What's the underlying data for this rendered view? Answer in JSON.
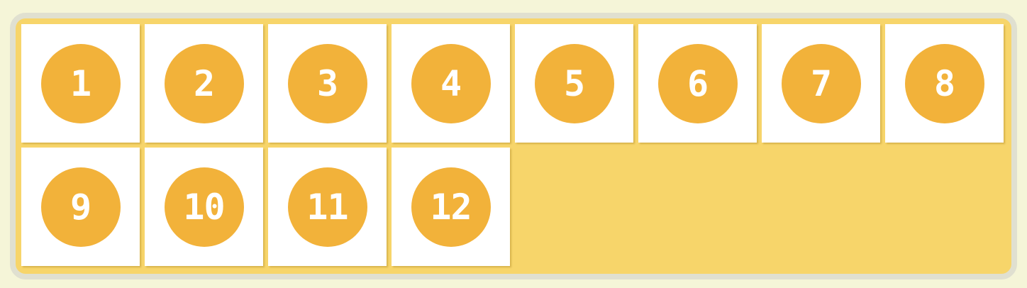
{
  "colors": {
    "page_background": "#f5f5d8",
    "frame_border": "#e0e0d0",
    "container_background": "#f7d56a",
    "tile_background": "#ffffff",
    "badge_background": "#f2b23a",
    "badge_text": "#ffffff"
  },
  "grid": {
    "items": [
      {
        "label": "1"
      },
      {
        "label": "2"
      },
      {
        "label": "3"
      },
      {
        "label": "4"
      },
      {
        "label": "5"
      },
      {
        "label": "6"
      },
      {
        "label": "7"
      },
      {
        "label": "8"
      },
      {
        "label": "9"
      },
      {
        "label": "10"
      },
      {
        "label": "11"
      },
      {
        "label": "12"
      }
    ]
  }
}
